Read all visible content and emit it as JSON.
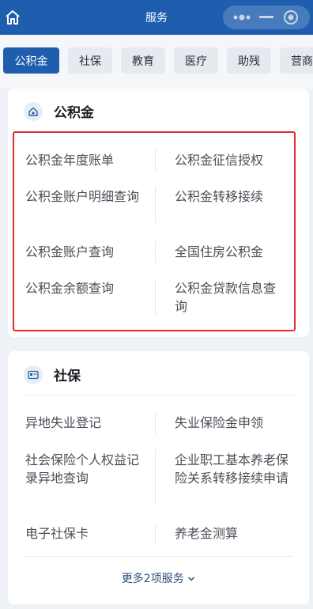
{
  "header": {
    "title": "服务",
    "home_icon": "home-icon",
    "capsule_icons": [
      "more-dots-icon",
      "minimize-icon",
      "close-target-icon"
    ]
  },
  "tabs": [
    "公积金",
    "社保",
    "教育",
    "医疗",
    "助残",
    "营商"
  ],
  "gjj": {
    "title": "公积金",
    "items": [
      "公积金年度账单",
      "公积金征信授权",
      "公积金账户明细查询",
      "公积金转移接续",
      "公积金账户查询",
      "全国住房公积金",
      "公积金余额查询",
      "公积金贷款信息查询"
    ]
  },
  "shebao": {
    "title": "社保",
    "items": [
      "异地失业登记",
      "失业保险金申领",
      "社会保险个人权益记录异地查询",
      "企业职工基本养老保险关系转移接续申请",
      "电子社保卡",
      "养老金测算"
    ],
    "more": "更多2项服务"
  },
  "colors": {
    "brand": "#1f5eae",
    "highlight": "#e02e2e"
  }
}
